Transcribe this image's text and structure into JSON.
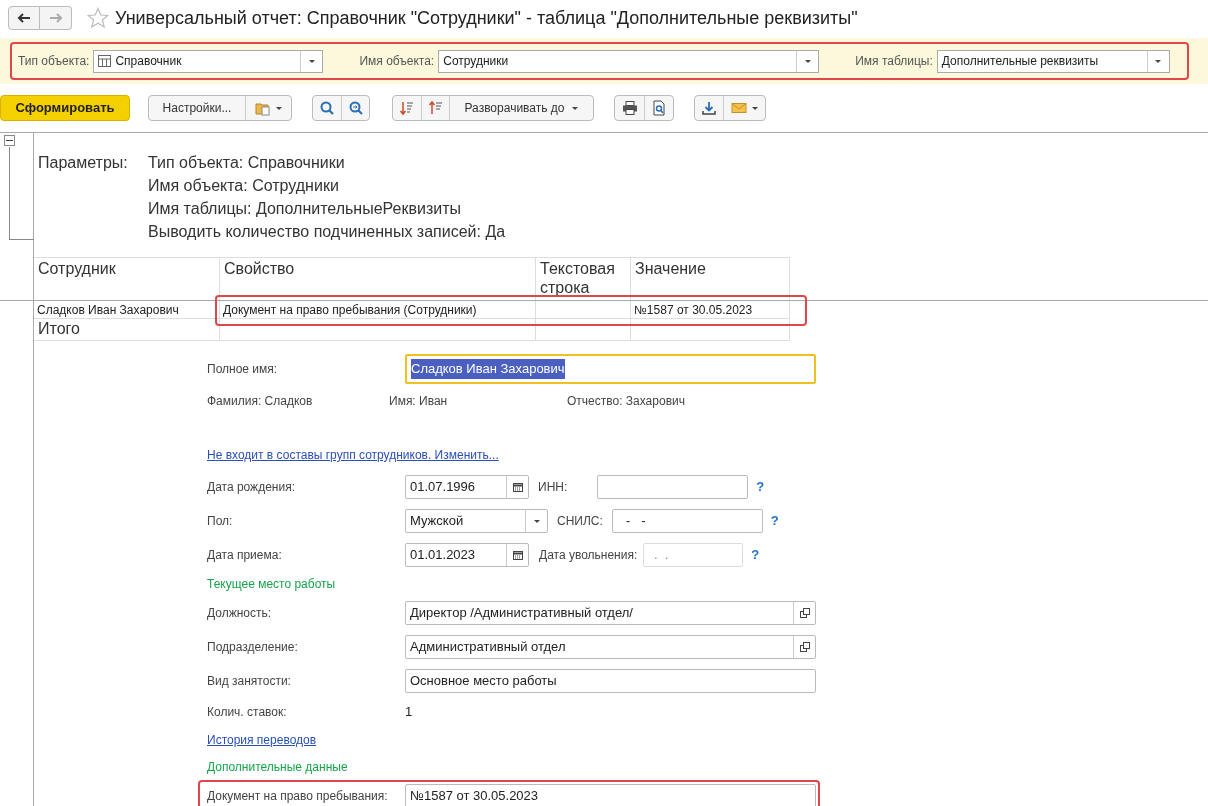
{
  "window": {
    "title": "Универсальный отчет: Справочник \"Сотрудники\" - таблица \"Дополнительные реквизиты\"",
    "favorite": false
  },
  "nav_buttons": [
    {
      "kind": "back",
      "disabled": false
    },
    {
      "kind": "forward",
      "disabled": true
    }
  ],
  "filter_bar": {
    "highlighted": true,
    "fields": [
      {
        "label": "Тип объекта:",
        "value": "Справочник",
        "kind": "with_icon"
      },
      {
        "label": "Имя объекта:",
        "value": "Сотрудники",
        "kind": "plain"
      },
      {
        "label": "Имя таблицы:",
        "value": "Дополнительные реквизиты",
        "kind": "plain"
      }
    ]
  },
  "toolbar": {
    "generate_button": "Сформировать",
    "settings_button": "Настройки...",
    "expand_button": "Разворачивать до"
  },
  "report": {
    "parameters_label": "Параметры:",
    "parameters": [
      "Тип объекта: Справочники",
      "Имя объекта: Сотрудники",
      "Имя таблицы: ДополнительныеРеквизиты",
      "Выводить количество подчиненных записей: Да"
    ],
    "table": {
      "columns": [
        "Сотрудник",
        "Свойство",
        "Текстовая строка",
        "Значение"
      ],
      "rows": [
        {
          "cells": [
            "Сладков Иван Захарович",
            "Документ на право пребывания (Сотрудники)",
            "",
            "№1587 от 30.05.2023"
          ],
          "highlighted": true
        }
      ],
      "total_label": "Итого"
    }
  },
  "form": {
    "rows": [
      {
        "kind": "field",
        "label": "Полное имя:",
        "value": "Сладков Иван Захарович",
        "focused": true,
        "text_selected": true
      },
      {
        "kind": "names",
        "items": [
          {
            "label": "Фамилия:",
            "value": "Сладков"
          },
          {
            "label": "Имя:",
            "value": "Иван"
          },
          {
            "label": "Отчество:",
            "value": "Захарович"
          }
        ]
      },
      {
        "kind": "link",
        "text": "Не входит в составы групп сотрудников. Изменить..."
      },
      {
        "kind": "date_pair",
        "label": "Дата рождения:",
        "value": "01.07.1996",
        "label2": "ИНН:",
        "help": "?",
        "disabled2": false
      },
      {
        "kind": "select_pair",
        "label": "Пол:",
        "value": "Мужской",
        "label2": "СНИЛС:",
        "value2": "  -   -",
        "help": "?",
        "disabled2": false
      },
      {
        "kind": "date_pair",
        "label": "Дата приема:",
        "value": "01.01.2023",
        "label2": "Дата увольнения:",
        "value2": " .  .",
        "help": "?",
        "disabled2": true
      },
      {
        "kind": "section",
        "text": "Текущее место работы"
      },
      {
        "kind": "field",
        "label": "Должность:",
        "value": "Директор /Административный отдел/",
        "open_button": true
      },
      {
        "kind": "field",
        "label": "Подразделение:",
        "value": "Административный отдел",
        "open_button": true
      },
      {
        "kind": "field",
        "label": "Вид занятости:",
        "value": "Основное место работы"
      },
      {
        "kind": "value",
        "label": "Колич. ставок:",
        "value": "1"
      },
      {
        "kind": "link",
        "text": "История переводов"
      },
      {
        "kind": "section",
        "text": "Дополнительные данные"
      },
      {
        "kind": "field",
        "label": "Документ на право пребывания:",
        "value": "№1587 от 30.05.2023",
        "highlighted": true
      }
    ]
  }
}
